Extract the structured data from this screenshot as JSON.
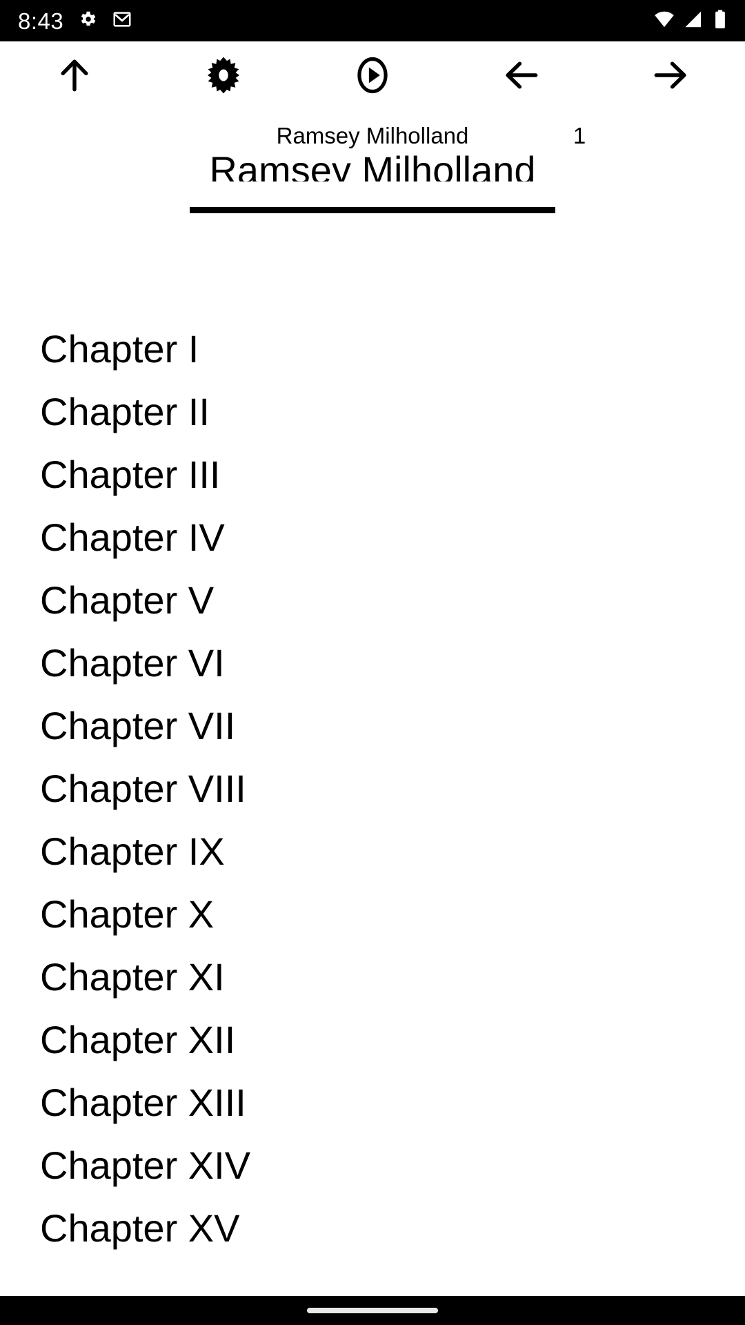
{
  "status_bar": {
    "time": "8:43",
    "icons": [
      "gear-icon",
      "gmail-icon",
      "wifi-icon",
      "cellular-signal-icon",
      "battery-icon"
    ],
    "background_color": "#000000",
    "foreground_color": "#ffffff"
  },
  "toolbar": {
    "buttons": [
      {
        "name": "scroll-up-button",
        "icon": "arrow-up-icon"
      },
      {
        "name": "settings-button",
        "icon": "gear-icon"
      },
      {
        "name": "play-button",
        "icon": "play-circle-icon"
      },
      {
        "name": "previous-page-button",
        "icon": "arrow-left-icon"
      },
      {
        "name": "next-page-button",
        "icon": "arrow-right-icon"
      }
    ]
  },
  "document": {
    "running_head": "Ramsey Milholland",
    "page_number": "1",
    "book_title": "Ramsey Milholland",
    "toc": [
      "Chapter I",
      "Chapter II",
      "Chapter III",
      "Chapter IV",
      "Chapter V",
      "Chapter VI",
      "Chapter VII",
      "Chapter VIII",
      "Chapter IX",
      "Chapter X",
      "Chapter XI",
      "Chapter XII",
      "Chapter XIII",
      "Chapter XIV",
      "Chapter XV"
    ]
  },
  "nav_bar": {
    "gesture_pill": "home-gesture-pill",
    "background_color": "#000000"
  }
}
